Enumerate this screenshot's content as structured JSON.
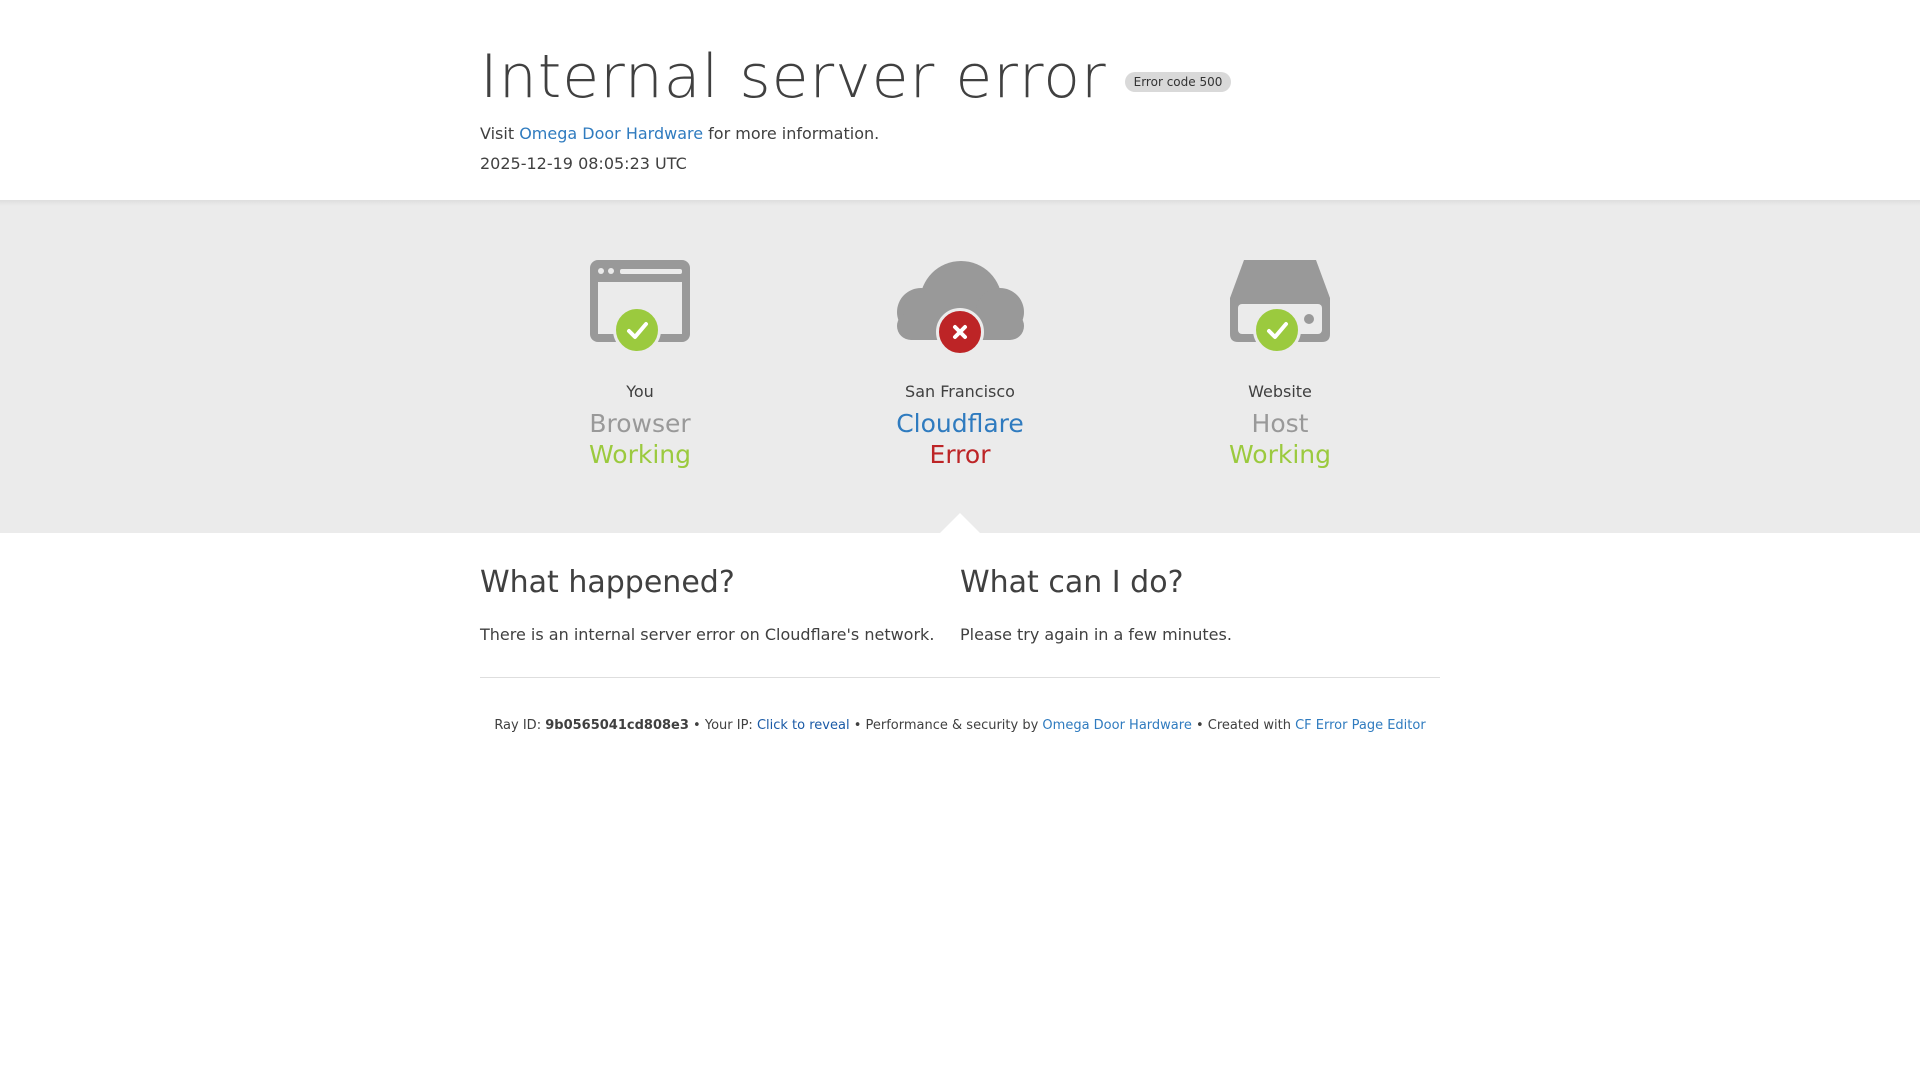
{
  "header": {
    "title": "Internal server error",
    "error_badge": "Error code 500",
    "visit_prefix": "Visit",
    "site_link": "Omega Door Hardware",
    "visit_suffix": "for more information.",
    "timestamp": "2025-12-19 08:05:23 UTC"
  },
  "status": {
    "browser": {
      "label": "You",
      "name": "Browser",
      "state": "Working",
      "icon": "check-icon"
    },
    "cloudflare": {
      "label": "San Francisco",
      "name": "Cloudflare",
      "state": "Error",
      "icon": "x-icon"
    },
    "host": {
      "label": "Website",
      "name": "Host",
      "state": "Working",
      "icon": "check-icon"
    }
  },
  "info": {
    "what_happened_title": "What happened?",
    "what_happened_text": "There is an internal server error on Cloudflare's network.",
    "what_can_i_do_title": "What can I do?",
    "what_can_i_do_text": "Please try again in a few minutes."
  },
  "footer": {
    "ray_label": "Ray ID:",
    "ray_id": "9b0565041cd808e3",
    "sep": "•",
    "ip_label": "Your IP:",
    "ip_reveal": "Click to reveal",
    "perf_label": "Performance & security by",
    "perf_link": "Omega Door Hardware",
    "created_label": "Created with",
    "created_link": "CF Error Page Editor"
  },
  "colors": {
    "working": "#9bca3e",
    "error": "#bd2426",
    "link": "#2f7bbf",
    "icon_gray": "#999999",
    "band": "#ebebeb"
  }
}
